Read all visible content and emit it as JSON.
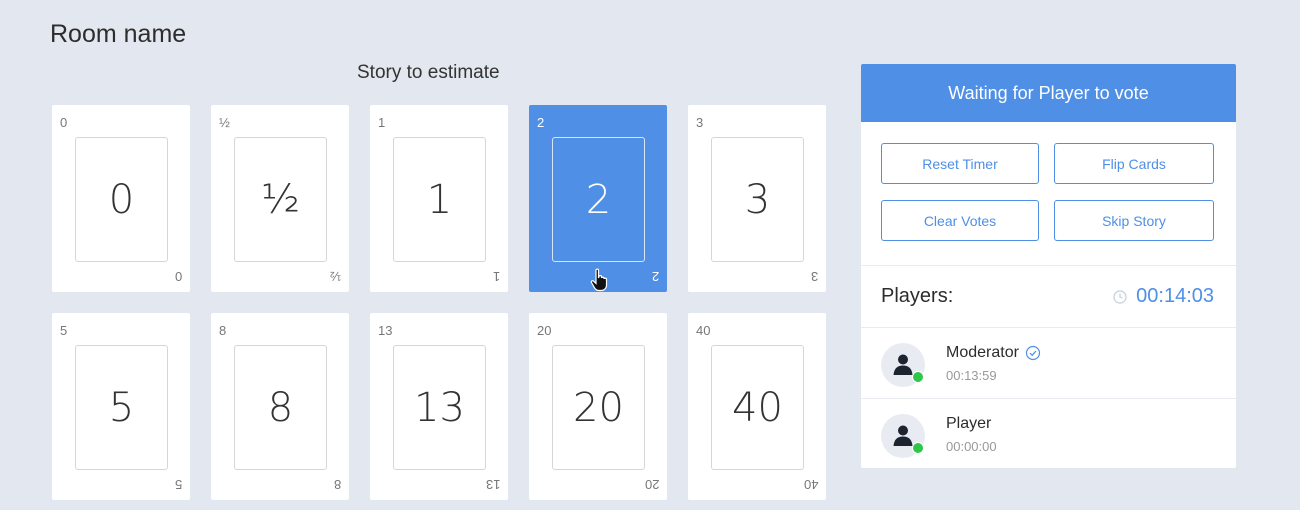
{
  "room": {
    "title": "Room name"
  },
  "story": {
    "title": "Story to estimate"
  },
  "cards": [
    {
      "value": "0",
      "corner": "0"
    },
    {
      "value": "½",
      "corner": "½"
    },
    {
      "value": "1",
      "corner": "1"
    },
    {
      "value": "2",
      "corner": "2",
      "selected": true
    },
    {
      "value": "3",
      "corner": "3"
    },
    {
      "value": "5",
      "corner": "5"
    },
    {
      "value": "8",
      "corner": "8"
    },
    {
      "value": "13",
      "corner": "13"
    },
    {
      "value": "20",
      "corner": "20"
    },
    {
      "value": "40",
      "corner": "40"
    }
  ],
  "panel": {
    "status": "Waiting for Player to vote",
    "buttons": {
      "reset_timer": "Reset Timer",
      "flip_cards": "Flip Cards",
      "clear_votes": "Clear Votes",
      "skip_story": "Skip Story"
    },
    "players_label": "Players:",
    "timer": "00:14:03",
    "players": [
      {
        "name": "Moderator",
        "time": "00:13:59",
        "verified": true
      },
      {
        "name": "Player",
        "time": "00:00:00",
        "verified": false
      }
    ]
  },
  "colors": {
    "accent": "#4f8fe6",
    "background": "#e3e7ef",
    "online": "#2fc64a"
  }
}
